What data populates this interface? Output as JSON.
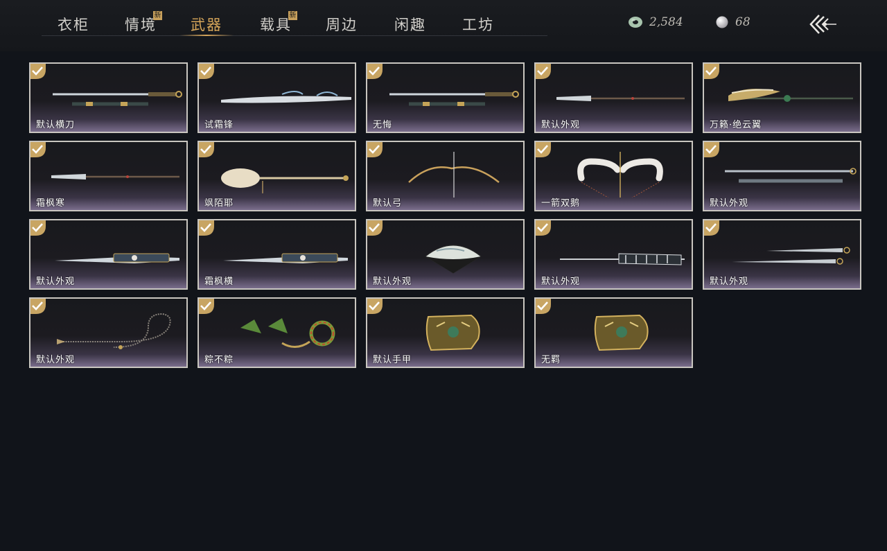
{
  "tabs": [
    {
      "label": "衣柜",
      "new": false,
      "active": false
    },
    {
      "label": "情境",
      "new": true,
      "active": false
    },
    {
      "label": "武器",
      "new": false,
      "active": true
    },
    {
      "label": "载具",
      "new": true,
      "active": false
    },
    {
      "label": "周边",
      "new": false,
      "active": false
    },
    {
      "label": "闲趣",
      "new": false,
      "active": false
    },
    {
      "label": "工坊",
      "new": false,
      "active": false
    }
  ],
  "new_badge_label": "新",
  "currency": {
    "jade": {
      "icon": "jade-coin-icon",
      "value": "2,584"
    },
    "pearl": {
      "icon": "pearl-icon",
      "value": "68"
    }
  },
  "back_icon": "back-arrow-icon",
  "items": [
    {
      "name": "默认横刀",
      "icon": "sword-icon",
      "owned": true
    },
    {
      "name": "试霜锋",
      "icon": "frost-sword-icon",
      "owned": true
    },
    {
      "name": "无悔",
      "icon": "sword-icon",
      "owned": true
    },
    {
      "name": "默认外观",
      "icon": "spear-icon",
      "owned": true
    },
    {
      "name": "万籁·绝云翼",
      "icon": "winged-spear-icon",
      "owned": true
    },
    {
      "name": "霜枫寒",
      "icon": "spear-icon",
      "owned": true
    },
    {
      "name": "飒陌耶",
      "icon": "staff-icon",
      "owned": true
    },
    {
      "name": "默认弓",
      "icon": "bow-icon",
      "owned": true
    },
    {
      "name": "一箭双鹅",
      "icon": "swan-bow-icon",
      "owned": true
    },
    {
      "name": "默认外观",
      "icon": "twin-sword-icon",
      "owned": true
    },
    {
      "name": "默认外观",
      "icon": "blade-icon",
      "owned": true
    },
    {
      "name": "霜枫横",
      "icon": "blade-icon",
      "owned": true
    },
    {
      "name": "默认外观",
      "icon": "fan-icon",
      "owned": true
    },
    {
      "name": "默认外观",
      "icon": "umbrella-icon",
      "owned": true
    },
    {
      "name": "默认外观",
      "icon": "dual-blade-icon",
      "owned": true
    },
    {
      "name": "默认外观",
      "icon": "rope-dart-icon",
      "owned": true
    },
    {
      "name": "粽不粽",
      "icon": "zongzi-weapon-icon",
      "owned": true
    },
    {
      "name": "默认手甲",
      "icon": "gauntlet-icon",
      "owned": true
    },
    {
      "name": "无羁",
      "icon": "gauntlet-icon",
      "owned": true
    }
  ]
}
